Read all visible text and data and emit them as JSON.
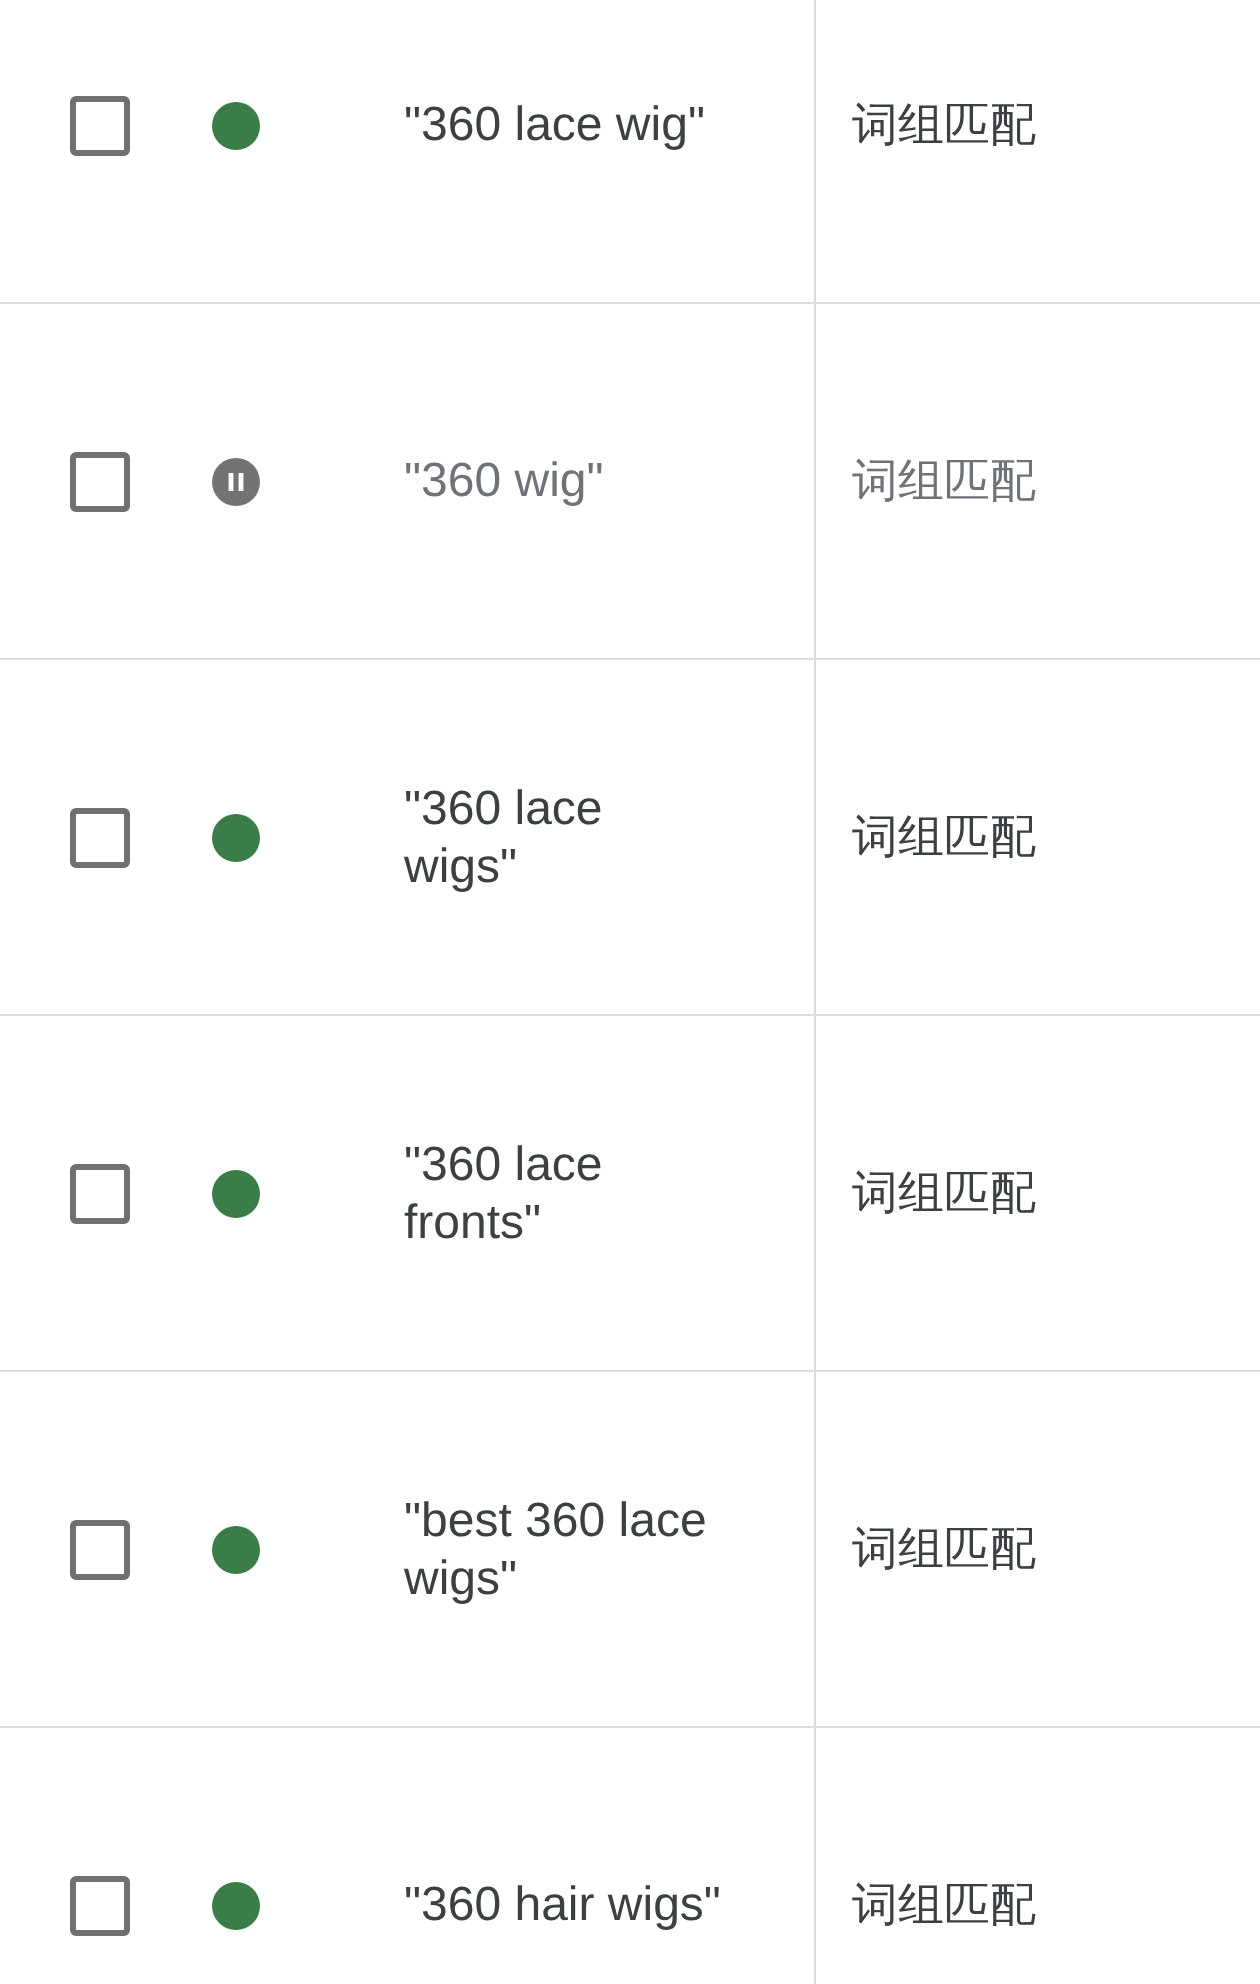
{
  "rows": [
    {
      "checked": false,
      "paused": false,
      "keyword": "\"360 lace wig\"",
      "match_type": "词组匹配"
    },
    {
      "checked": false,
      "paused": true,
      "keyword": "\"360 wig\"",
      "match_type": "词组匹配"
    },
    {
      "checked": false,
      "paused": false,
      "keyword": "\"360 lace wigs\"",
      "match_type": "词组匹配"
    },
    {
      "checked": false,
      "paused": false,
      "keyword": "\"360 lace fronts\"",
      "match_type": "词组匹配"
    },
    {
      "checked": false,
      "paused": false,
      "keyword": "\"best 360 lace wigs\"",
      "match_type": "词组匹配"
    },
    {
      "checked": false,
      "paused": false,
      "keyword": "\"360 hair wigs\"",
      "match_type": "词组匹配"
    }
  ]
}
